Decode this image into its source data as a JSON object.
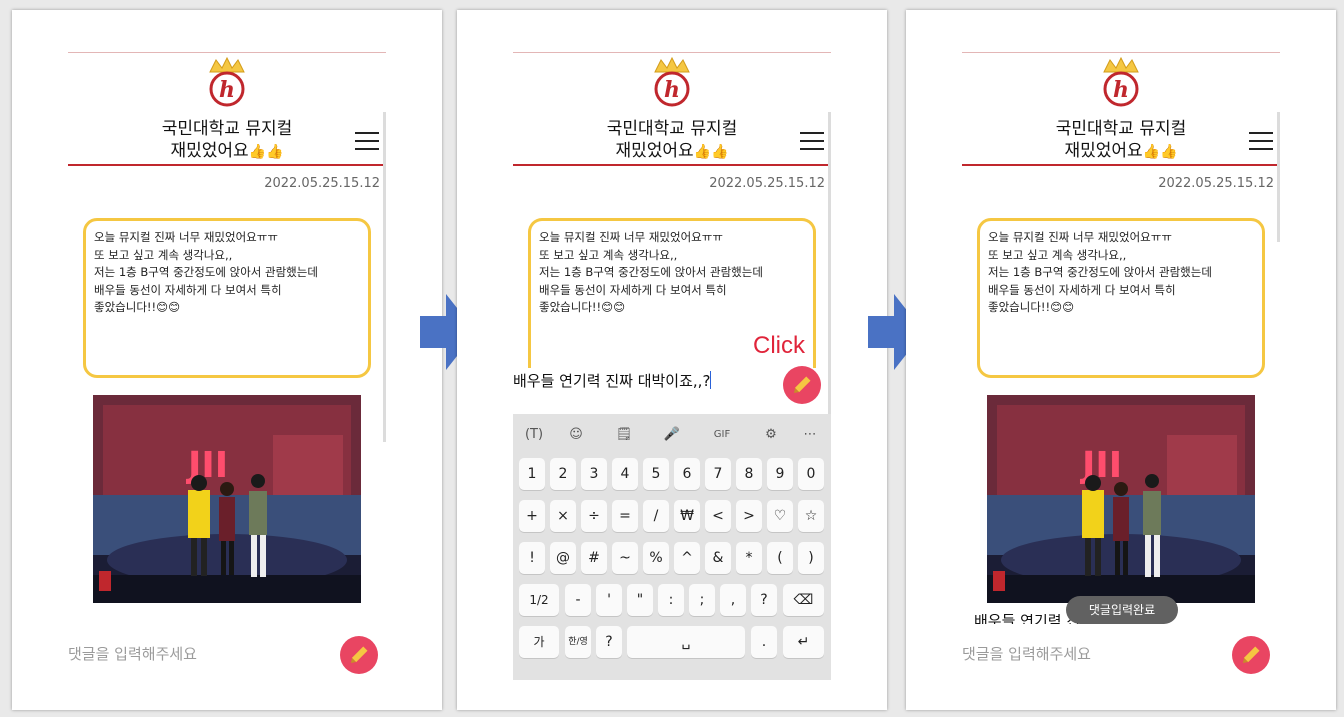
{
  "post": {
    "title_line1": "국민대학교 뮤지컬",
    "title_line2": "재밌었어요",
    "title_emoji": "👍👍",
    "datetime": "2022.05.25.15.12",
    "content_lines": [
      "오늘 뮤지컬 진짜 너무 재밌었어요ㅠㅠ",
      "또 보고 싶고 계속 생각나요,,",
      "저는 1층 B구역 중간정도에 앉아서 관람했는데",
      "배우들 동선이 자세하게 다 보여서 특히",
      "좋았습니다!!😊😊"
    ]
  },
  "comment": {
    "placeholder": "댓글을 입력해주세요",
    "typed_text": "배우들 연기력 진짜 대박이죠,,?",
    "toast": "댓글입력완료"
  },
  "annotation": {
    "click_label": "Click"
  },
  "keyboard": {
    "row1": [
      "1",
      "2",
      "3",
      "4",
      "5",
      "6",
      "7",
      "8",
      "9",
      "0"
    ],
    "row2": [
      "+",
      "×",
      "÷",
      "=",
      "/",
      "₩",
      "<",
      ">",
      "♡",
      "☆"
    ],
    "row3": [
      "!",
      "@",
      "#",
      "~",
      "%",
      "^",
      "&",
      "*",
      "(",
      ")"
    ],
    "row4": [
      "1/2",
      "-",
      "'",
      "\"",
      ":",
      ";",
      ",",
      "?",
      "⌫"
    ],
    "row5": [
      "가",
      "한/영",
      "?",
      "␣",
      ".",
      "↵"
    ],
    "toolbar": [
      "(T)",
      "☺",
      "🗒",
      "🎤",
      "GIF",
      "⚙",
      "⋯"
    ]
  },
  "colors": {
    "accent_red": "#c0272d",
    "card_border": "#f5c742",
    "fab": "#e94562",
    "arrow": "#4a72c4",
    "click_text": "#e0243a"
  }
}
